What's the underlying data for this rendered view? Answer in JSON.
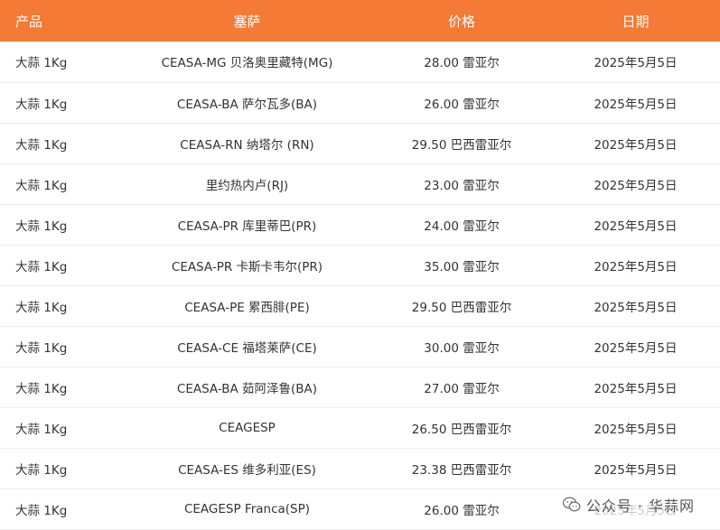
{
  "header": {
    "product": "产品",
    "market": "塞萨",
    "price": "价格",
    "date": "日期"
  },
  "rows": [
    {
      "product": "大蒜 1Kg",
      "market": "CEASA-MG 贝洛奥里藏特(MG)",
      "price": "28.00 雷亚尔",
      "date": "2025年5月5日"
    },
    {
      "product": "大蒜 1Kg",
      "market": "CEASA-BA 萨尔瓦多(BA)",
      "price": "26.00 雷亚尔",
      "date": "2025年5月5日"
    },
    {
      "product": "大蒜 1Kg",
      "market": "CEASA-RN 纳塔尔 (RN)",
      "price": "29.50 巴西雷亚尔",
      "date": "2025年5月5日"
    },
    {
      "product": "大蒜 1Kg",
      "market": "里约热内卢(RJ)",
      "price": "23.00 雷亚尔",
      "date": "2025年5月5日"
    },
    {
      "product": "大蒜 1Kg",
      "market": "CEASA-PR 库里蒂巴(PR)",
      "price": "24.00 雷亚尔",
      "date": "2025年5月5日"
    },
    {
      "product": "大蒜 1Kg",
      "market": "CEASA-PR 卡斯卡韦尔(PR)",
      "price": "35.00 雷亚尔",
      "date": "2025年5月5日"
    },
    {
      "product": "大蒜 1Kg",
      "market": "CEASA-PE 累西腓(PE)",
      "price": "29.50 巴西雷亚尔",
      "date": "2025年5月5日"
    },
    {
      "product": "大蒜 1Kg",
      "market": "CEASA-CE 福塔莱萨(CE)",
      "price": "30.00 雷亚尔",
      "date": "2025年5月5日"
    },
    {
      "product": "大蒜 1Kg",
      "market": "CEASA-BA 茹阿泽鲁(BA)",
      "price": "27.00 雷亚尔",
      "date": "2025年5月5日"
    },
    {
      "product": "大蒜 1Kg",
      "market": "CEAGESP",
      "price": "26.50 巴西雷亚尔",
      "date": "2025年5月5日"
    },
    {
      "product": "大蒜 1Kg",
      "market": "CEASA-ES 维多利亚(ES)",
      "price": "23.38 巴西雷亚尔",
      "date": "2025年5月5日"
    },
    {
      "product": "大蒜 1Kg",
      "market": "CEAGESP Franca(SP)",
      "price": "26.00 雷亚尔",
      "date": "2025年5月5日"
    }
  ],
  "watermark": {
    "icon": "wechat-icon",
    "text": "公众号 · 华蒜网"
  },
  "colors": {
    "header_bg": "#f47a36",
    "header_text": "#ffffff",
    "row_divider": "#ececec"
  }
}
